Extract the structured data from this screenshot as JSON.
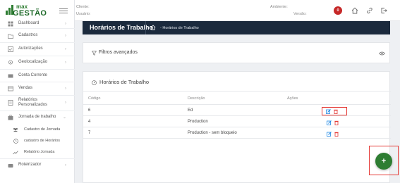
{
  "brand": {
    "top": "max",
    "bottom": "GESTÃO",
    "color": "#2e7d32"
  },
  "header": {
    "cliente_label": "Cliente:",
    "usuario_label": "Usuário:",
    "ambiente_label": "Ambiente:",
    "versao_label": "Versão:",
    "notification_count": "0"
  },
  "sidebar": {
    "items": [
      {
        "label": "Dashboard",
        "icon": "dashboard-icon"
      },
      {
        "label": "Cadastros",
        "icon": "folder-icon"
      },
      {
        "label": "Autorizações",
        "icon": "check-list-icon"
      },
      {
        "label": "Geolocalização",
        "icon": "location-icon"
      },
      {
        "label": "Conta Corrente",
        "icon": "wallet-icon"
      },
      {
        "label": "Vendas",
        "icon": "cart-icon"
      },
      {
        "label": "Relatórios Personalizados",
        "icon": "report-icon"
      },
      {
        "label": "Jornada de trabalho",
        "icon": "briefcase-icon"
      }
    ],
    "subitems": [
      {
        "label": "Cadastro de Jornada",
        "icon": "users-icon"
      },
      {
        "label": "cadastro de Horários",
        "icon": "clock-icon"
      },
      {
        "label": "Relatório Jornada",
        "icon": "chart-line-icon"
      }
    ],
    "last_item": {
      "label": "Roteirizador",
      "icon": "route-icon"
    }
  },
  "page": {
    "title": "Horários de Trabalho",
    "breadcrumb": "- Horários de Trabalho"
  },
  "filters": {
    "label": "Filtros avançados"
  },
  "table": {
    "title": "Horários de Trabalho",
    "columns": {
      "codigo": "Código",
      "descricao": "Descrição",
      "acoes": "Ações"
    },
    "rows": [
      {
        "codigo": "6",
        "descricao": "Ed"
      },
      {
        "codigo": "4",
        "descricao": "Production"
      },
      {
        "codigo": "7",
        "descricao": "Production - sem bloqueio"
      }
    ]
  },
  "fab": {
    "label": "+"
  },
  "colors": {
    "titlebar": "#1b2a3d",
    "accent": "#2e7d32",
    "highlight": "#e53935",
    "edit": "#1e88e5",
    "delete": "#e53935"
  }
}
